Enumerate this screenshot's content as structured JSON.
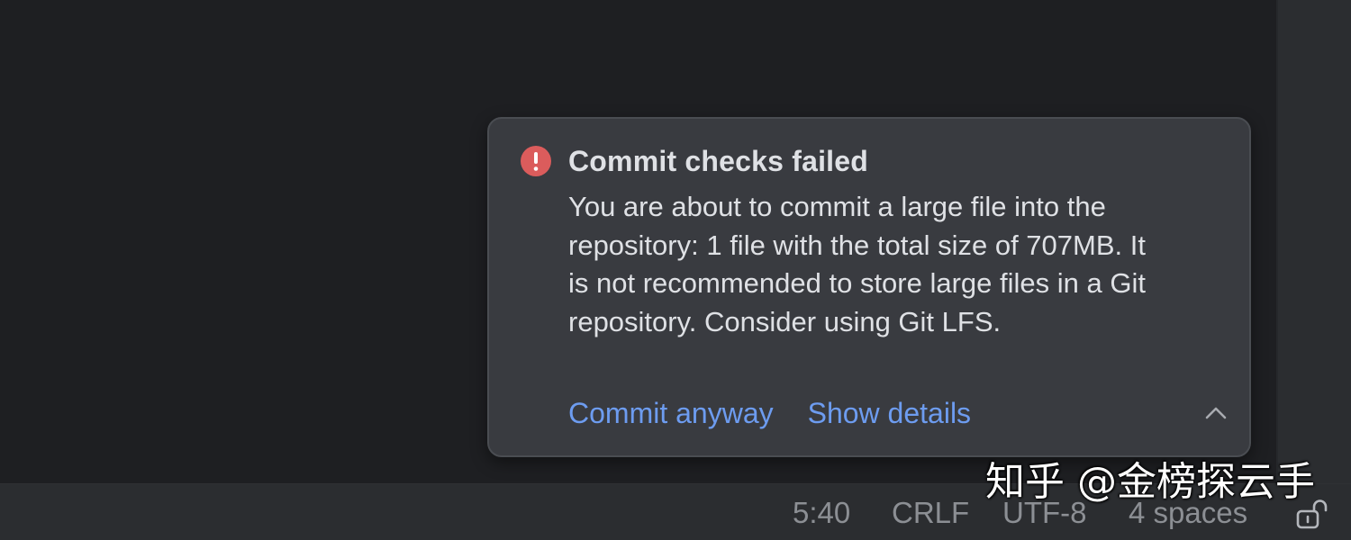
{
  "notification": {
    "severity": "error",
    "icon": "error-exclamation-icon",
    "title": "Commit checks failed",
    "message": "You are about to commit a large file into the repository: 1 file with the total size of 707MB. It is not recommended to store large files in a Git repository. Consider using Git LFS.",
    "actions": [
      {
        "label": "Commit anyway"
      },
      {
        "label": "Show details"
      }
    ],
    "collapse_icon": "chevron-up-icon"
  },
  "status_bar": {
    "caret_position": "5:40",
    "line_separator": "CRLF",
    "encoding": "UTF-8",
    "indent": "4 spaces",
    "lock_icon": "unlocked-padlock-icon"
  },
  "watermark": {
    "text": "知乎 @金榜探云手"
  },
  "colors": {
    "editor_bg": "#1e1f22",
    "panel_bg": "#2b2d30",
    "popup_bg": "#393b40",
    "error_red": "#db5c5c",
    "link_blue": "#6d9cf0",
    "text_primary": "#dfe1e5",
    "text_secondary": "#8c8f94"
  }
}
